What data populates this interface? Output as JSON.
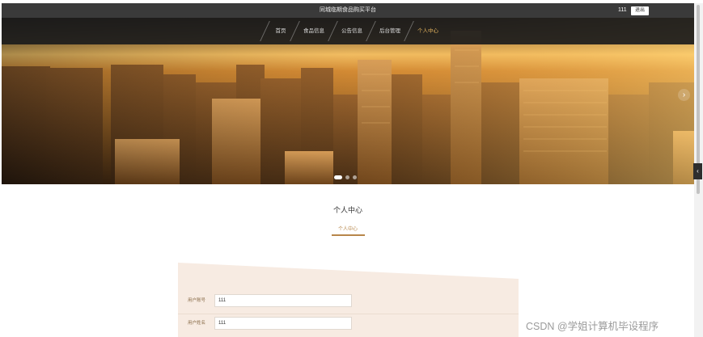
{
  "header": {
    "site_title": "同城临期食品购买平台",
    "user_name": "111",
    "logout_label": "退出"
  },
  "nav": {
    "items": [
      {
        "label": "首页"
      },
      {
        "label": "食品信息"
      },
      {
        "label": "公告信息"
      },
      {
        "label": "后台管理"
      },
      {
        "label": "个人中心"
      }
    ],
    "active_label": "个人中心"
  },
  "carousel": {
    "slide_count": 3,
    "active_index": 0,
    "next_icon": "chevron-right-icon"
  },
  "side_toggle": {
    "icon": "chevron-left-icon"
  },
  "section": {
    "title": "个人中心",
    "subtitle": "个人中心"
  },
  "form": {
    "fields": [
      {
        "label": "用户账号",
        "value": "111"
      },
      {
        "label": "用户姓名",
        "value": "111"
      }
    ]
  },
  "watermark": {
    "text": "CSDN @学姐计算机毕设程序"
  },
  "colors": {
    "topbar": "#3a3a3a",
    "accent": "#b7864a",
    "nav_active": "#e3b35e",
    "form_bg": "#f7ebe2"
  }
}
